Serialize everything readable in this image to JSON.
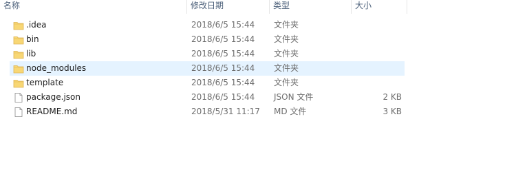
{
  "columns": {
    "name": "名称",
    "date": "修改日期",
    "type": "类型",
    "size": "大小"
  },
  "files": [
    {
      "name": ".idea",
      "date": "2018/6/5 15:44",
      "type": "文件夹",
      "size": "",
      "icon": "folder-icon"
    },
    {
      "name": "bin",
      "date": "2018/6/5 15:44",
      "type": "文件夹",
      "size": "",
      "icon": "folder-icon"
    },
    {
      "name": "lib",
      "date": "2018/6/5 15:44",
      "type": "文件夹",
      "size": "",
      "icon": "folder-icon"
    },
    {
      "name": "node_modules",
      "date": "2018/6/5 15:44",
      "type": "文件夹",
      "size": "",
      "icon": "folder-icon"
    },
    {
      "name": "template",
      "date": "2018/6/5 15:44",
      "type": "文件夹",
      "size": "",
      "icon": "folder-icon"
    },
    {
      "name": "package.json",
      "date": "2018/6/5 15:44",
      "type": "JSON 文件",
      "size": "2 KB",
      "icon": "file-icon"
    },
    {
      "name": "README.md",
      "date": "2018/5/31 11:17",
      "type": "MD 文件",
      "size": "3 KB",
      "icon": "file-icon"
    }
  ],
  "colors": {
    "hover_row": "#e5f3ff",
    "folder": "#f8d775",
    "header_text": "#4c607a"
  }
}
